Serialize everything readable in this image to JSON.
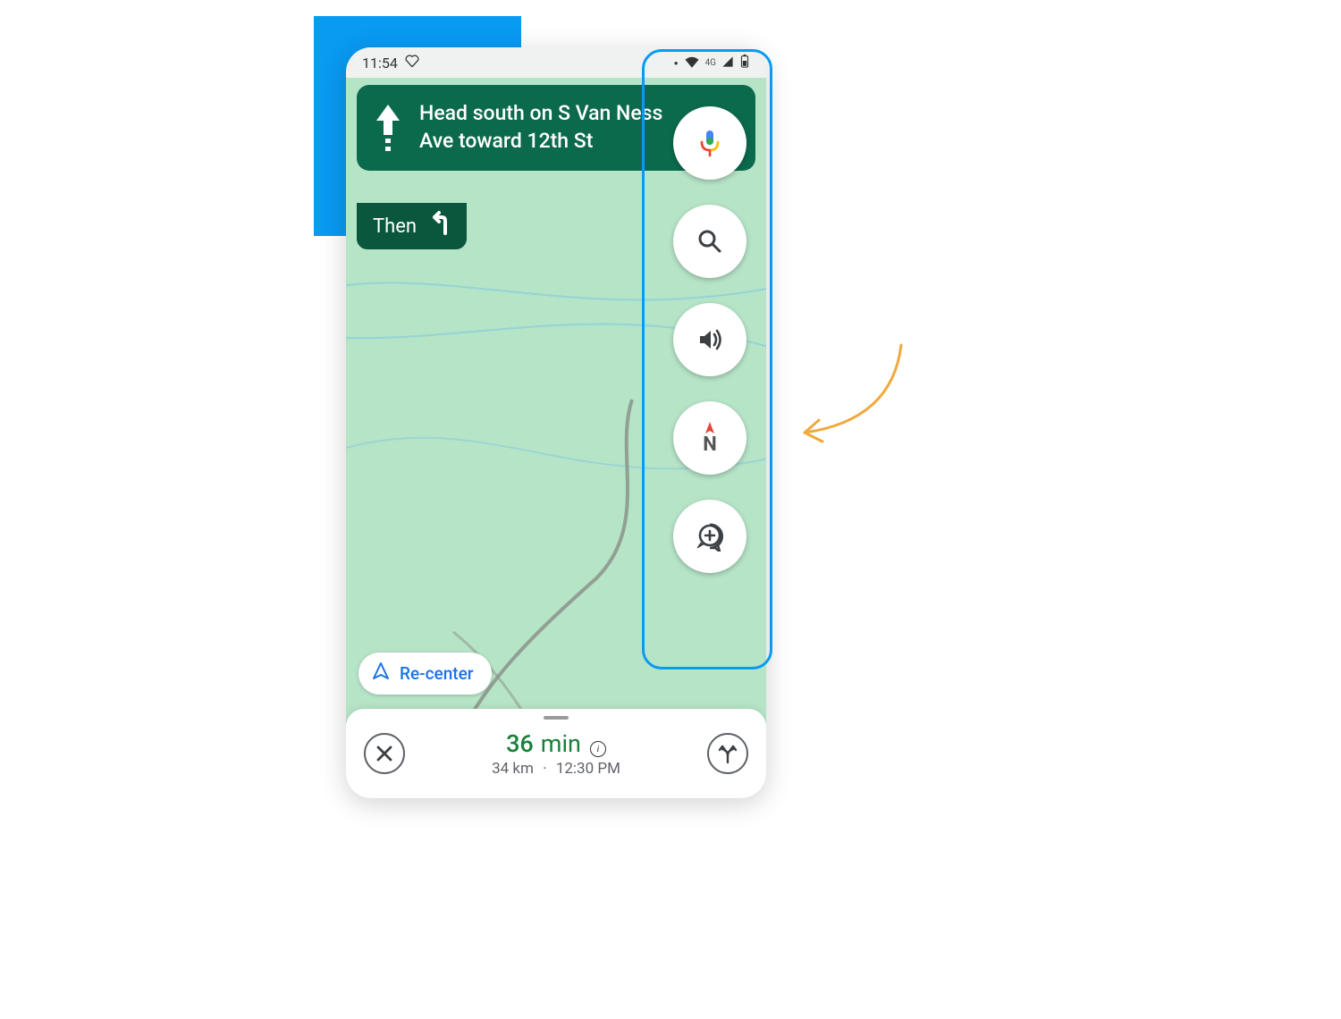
{
  "status_bar": {
    "time": "11:54",
    "network_label": "4G"
  },
  "direction": {
    "instruction": "Head south on S Van Ness Ave toward 12th St",
    "then_label": "Then"
  },
  "fabs": {
    "voice": "voice-search",
    "search": "search",
    "sound": "sound",
    "compass_letter": "N",
    "report": "report"
  },
  "recenter": {
    "label": "Re-center"
  },
  "eta": {
    "duration_value": "36",
    "duration_unit": "min",
    "distance": "34 km",
    "separator": "·",
    "arrival": "12:30 PM"
  },
  "colors": {
    "accent_blue": "#099AF2",
    "direction_green": "#0c6a4c",
    "eta_green": "#188038",
    "link_blue": "#1a73e8",
    "annotation": "#f0a93c"
  }
}
